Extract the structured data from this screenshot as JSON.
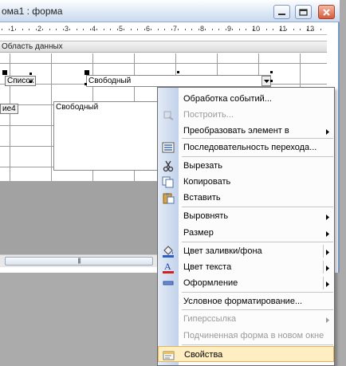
{
  "window": {
    "title": "ома1 : форма"
  },
  "ruler": {
    "numbers": [
      "1",
      "2",
      "3",
      "4",
      "5",
      "6",
      "7",
      "8",
      "9",
      "10",
      "11",
      "12"
    ]
  },
  "section": {
    "title": "Область данных"
  },
  "controls": {
    "label_list": "Список",
    "combo_text": "Свободный",
    "label_partial": "ие4",
    "textbox_text": "Свободный"
  },
  "context_menu": {
    "items": [
      {
        "label": "Обработка событий...",
        "icon": "none",
        "enabled": true,
        "submenu": false
      },
      {
        "label": "Построить...",
        "icon": "build-icon",
        "enabled": false,
        "submenu": false
      },
      {
        "label": "Преобразовать элемент в",
        "icon": "none",
        "enabled": true,
        "submenu": true
      },
      {
        "label": "Последовательность перехода...",
        "icon": "tab-order-icon",
        "enabled": true,
        "submenu": false
      },
      {
        "label": "Вырезать",
        "icon": "scissors-icon",
        "enabled": true,
        "submenu": false
      },
      {
        "label": "Копировать",
        "icon": "copy-icon",
        "enabled": true,
        "submenu": false
      },
      {
        "label": "Вставить",
        "icon": "paste-icon",
        "enabled": true,
        "submenu": false
      },
      {
        "label": "Выровнять",
        "icon": "none",
        "enabled": true,
        "submenu": true
      },
      {
        "label": "Размер",
        "icon": "none",
        "enabled": true,
        "submenu": true
      },
      {
        "label": "Цвет заливки/фона",
        "icon": "fill-color-icon",
        "enabled": true,
        "submenu": true
      },
      {
        "label": "Цвет текста",
        "icon": "font-color-icon",
        "enabled": true,
        "submenu": true
      },
      {
        "label": "Оформление",
        "icon": "special-effect-icon",
        "enabled": true,
        "submenu": true
      },
      {
        "label": "Условное форматирование...",
        "icon": "none",
        "enabled": true,
        "submenu": false
      },
      {
        "label": "Гиперссылка",
        "icon": "none",
        "enabled": false,
        "submenu": true
      },
      {
        "label": "Подчиненная форма в новом окне",
        "icon": "none",
        "enabled": false,
        "submenu": false
      },
      {
        "label": "Свойства",
        "icon": "properties-icon",
        "enabled": true,
        "submenu": false,
        "highlighted": true
      }
    ]
  },
  "colors": {
    "menu_highlight": "#ffeec2",
    "highlight_border": "#e5b25d",
    "strip": "#c9d8ee"
  }
}
